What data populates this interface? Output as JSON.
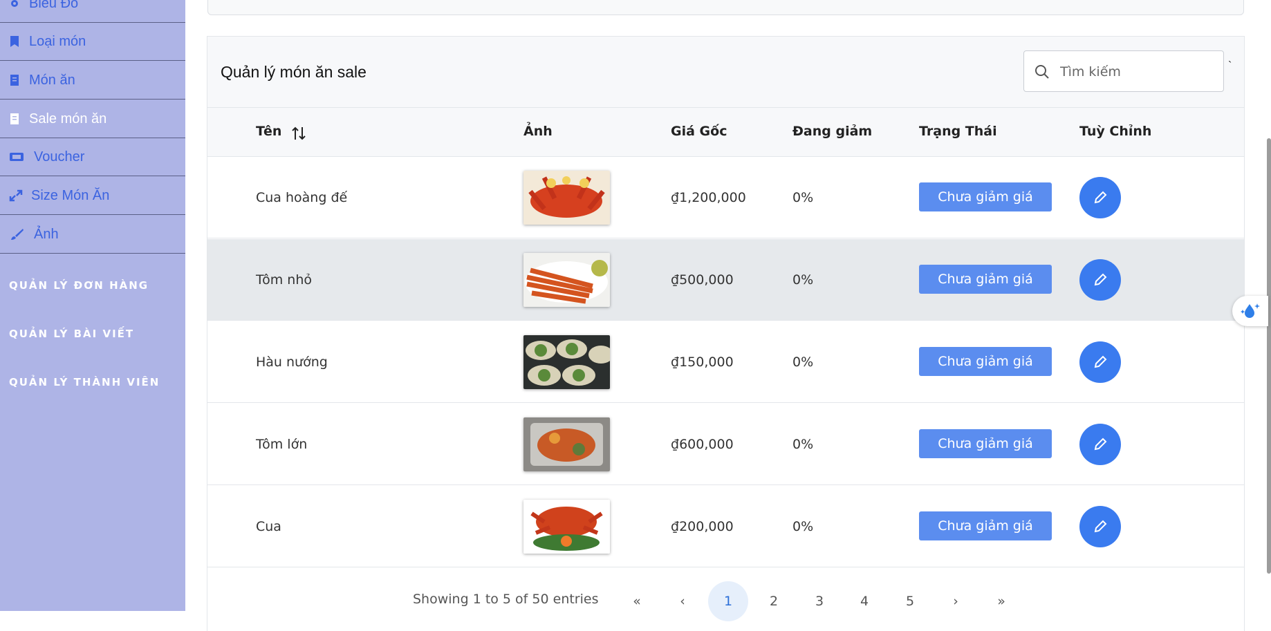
{
  "sidebar": {
    "items": [
      {
        "label": "Biểu Đồ",
        "icon": "gear-icon"
      },
      {
        "label": "Loại món",
        "icon": "bookmark-icon"
      },
      {
        "label": "Món ăn",
        "icon": "receipt-icon"
      },
      {
        "label": "Sale món ăn",
        "icon": "receipt-icon"
      },
      {
        "label": "Voucher",
        "icon": "ticket-icon"
      },
      {
        "label": "Size Món Ăn",
        "icon": "expand-icon"
      },
      {
        "label": "Ảnh",
        "icon": "brush-icon"
      }
    ],
    "active_item": "Sale món ăn",
    "sections": [
      "QUẢN LÝ ĐƠN HÀNG",
      "QUẢN LÝ BÀI VIẾT",
      "QUẢN LÝ THÀNH VIÊN"
    ]
  },
  "panel": {
    "title": "Quản lý món ăn sale",
    "search_placeholder": "Tìm kiếm",
    "tick": "`"
  },
  "table": {
    "headers": {
      "name": "Tên",
      "image": "Ảnh",
      "price": "Giá Gốc",
      "discount": "Đang giảm",
      "status": "Trạng Thái",
      "action": "Tuỳ Chỉnh"
    },
    "rows": [
      {
        "name": "Cua hoàng đế",
        "price": "₫1,200,000",
        "discount": "0%",
        "status": "Chưa giảm giá"
      },
      {
        "name": "Tôm nhỏ",
        "price": "₫500,000",
        "discount": "0%",
        "status": "Chưa giảm giá"
      },
      {
        "name": "Hàu nướng",
        "price": "₫150,000",
        "discount": "0%",
        "status": "Chưa giảm giá"
      },
      {
        "name": "Tôm lớn",
        "price": "₫600,000",
        "discount": "0%",
        "status": "Chưa giảm giá"
      },
      {
        "name": "Cua",
        "price": "₫200,000",
        "discount": "0%",
        "status": "Chưa giảm giá"
      }
    ],
    "highlighted_row": 1
  },
  "pagination": {
    "info": "Showing 1 to 5 of 50 entries",
    "first": "«",
    "prev": "‹",
    "pages": [
      "1",
      "2",
      "3",
      "4",
      "5"
    ],
    "current": "1",
    "next": "›",
    "last": "»"
  },
  "colors": {
    "sidebar_bg": "#aeb4e6",
    "accent": "#3a7bef",
    "status_button": "#5b8def"
  }
}
